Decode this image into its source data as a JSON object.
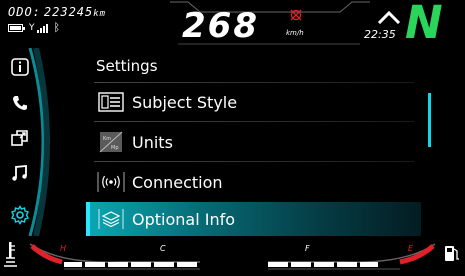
{
  "status": {
    "odo_label": "ODO:",
    "odo_value": "223245",
    "odo_unit": "km",
    "speed": "268",
    "speed_unit": "km/h",
    "time": "22:35",
    "gear": "N"
  },
  "sidebar": {
    "items": [
      {
        "icon": "info-icon"
      },
      {
        "icon": "phone-icon"
      },
      {
        "icon": "screen-switch-icon"
      },
      {
        "icon": "music-icon"
      },
      {
        "icon": "settings-gear-icon"
      }
    ]
  },
  "menu": {
    "title": "Settings",
    "items": [
      {
        "label": "Subject Style",
        "icon": "subject-style-icon",
        "selected": false
      },
      {
        "label": "Units",
        "icon": "units-icon",
        "selected": false
      },
      {
        "label": "Connection",
        "icon": "connection-icon",
        "selected": false
      },
      {
        "label": "Optional Info",
        "icon": "optional-info-icon",
        "selected": true
      }
    ]
  },
  "gauges": {
    "temp_low_label": "C",
    "temp_high_label": "H",
    "fuel_empty_label": "E",
    "fuel_full_label": "F"
  },
  "colors": {
    "accent": "#11d7e8",
    "gear": "#2bd45a",
    "warning": "#e0202a"
  }
}
